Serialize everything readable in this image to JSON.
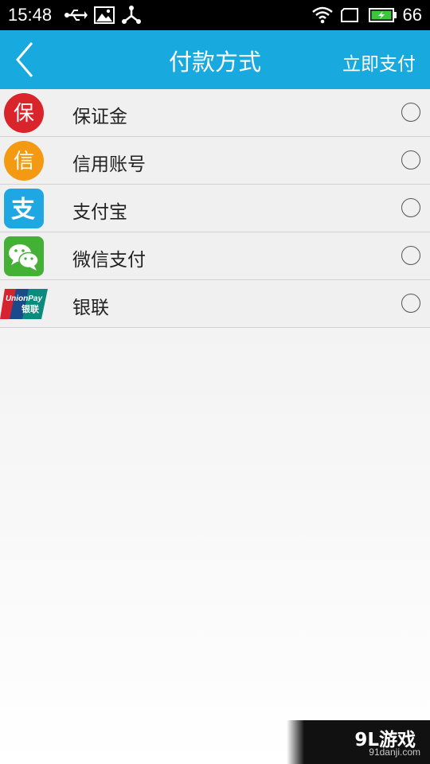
{
  "status_bar": {
    "time": "15:48",
    "battery_level": "66",
    "icons": [
      "usb-icon",
      "image-icon",
      "share-icon",
      "wifi-icon",
      "recent-apps-icon",
      "battery-icon"
    ]
  },
  "header": {
    "title": "付款方式",
    "action_label": "立即支付",
    "background_color": "#18a9df"
  },
  "payment_methods": [
    {
      "label": "保证金",
      "icon": "deposit-icon",
      "icon_text": "保",
      "color": "#d9242b",
      "selected": false
    },
    {
      "label": "信用账号",
      "icon": "credit-account-icon",
      "icon_text": "信",
      "color": "#f39a12",
      "selected": false
    },
    {
      "label": "支付宝",
      "icon": "alipay-icon",
      "icon_text": "支",
      "color": "#1fa7e3",
      "selected": false
    },
    {
      "label": "微信支付",
      "icon": "wechat-pay-icon",
      "color": "#44b035",
      "selected": false
    },
    {
      "label": "银联",
      "icon": "unionpay-icon",
      "icon_text": "UnionPay",
      "icon_subtext": "银联",
      "selected": false
    }
  ],
  "watermark": {
    "brand": "9L游戏",
    "url": "91danji.com"
  }
}
